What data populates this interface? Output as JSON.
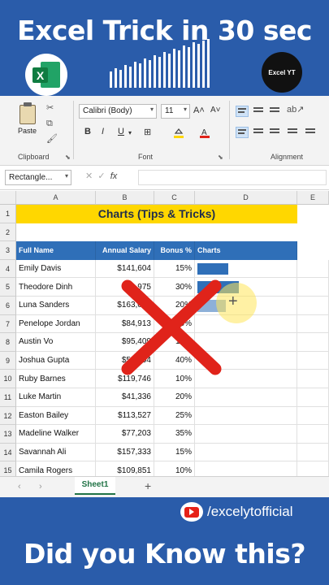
{
  "overlay": {
    "headline": "Excel Trick in 30 sec",
    "brand_logo_text": "Excel YT",
    "excel_logo_letter": "X",
    "social_handle": "/excelytofficial",
    "footer": "Did you Know this?"
  },
  "ribbon": {
    "paste_label": "Paste",
    "clipboard_label": "Clipboard",
    "font_name": "Calibri (Body)",
    "font_size": "11",
    "grow_font": "A˄",
    "shrink_font": "A˅",
    "bold": "B",
    "italic": "I",
    "underline": "U",
    "font_label": "Font",
    "alignment_label": "Alignment"
  },
  "formula_bar": {
    "name_box": "Rectangle...",
    "fx": "fx"
  },
  "sheet": {
    "column_headers": [
      "A",
      "B",
      "C",
      "D",
      "E"
    ],
    "title": "Charts (Tips & Tricks)",
    "headers": [
      "Full Name",
      "Annual Salary",
      "Bonus %",
      "Charts"
    ],
    "rows": [
      {
        "name": "Emily Davis",
        "salary": "$141,604",
        "bonus": "15%"
      },
      {
        "name": "Theodore Dinh",
        "salary": "$99,975",
        "bonus": "30%"
      },
      {
        "name": "Luna Sanders",
        "salary": "$163,099",
        "bonus": "20%"
      },
      {
        "name": "Penelope Jordan",
        "salary": "$84,913",
        "bonus": "10%"
      },
      {
        "name": "Austin Vo",
        "salary": "$95,409",
        "bonus": "10%"
      },
      {
        "name": "Joshua Gupta",
        "salary": "$50,994",
        "bonus": "40%"
      },
      {
        "name": "Ruby Barnes",
        "salary": "$119,746",
        "bonus": "10%"
      },
      {
        "name": "Luke Martin",
        "salary": "$41,336",
        "bonus": "20%"
      },
      {
        "name": "Easton Bailey",
        "salary": "$113,527",
        "bonus": "25%"
      },
      {
        "name": "Madeline Walker",
        "salary": "$77,203",
        "bonus": "35%"
      },
      {
        "name": "Savannah Ali",
        "salary": "$157,333",
        "bonus": "15%"
      },
      {
        "name": "Camila Rogers",
        "salary": "$109,851",
        "bonus": "10%"
      }
    ],
    "in_cell_bars": [
      0.54,
      0.73,
      0.5
    ],
    "bar_color": "#2f6fb8",
    "sheet_tab": "Sheet1",
    "add_sheet": "+"
  },
  "colors": {
    "background": "#2a5caa",
    "title_fill": "#ffd700",
    "header_fill": "#2f6fb8",
    "cross": "#e0231a"
  }
}
